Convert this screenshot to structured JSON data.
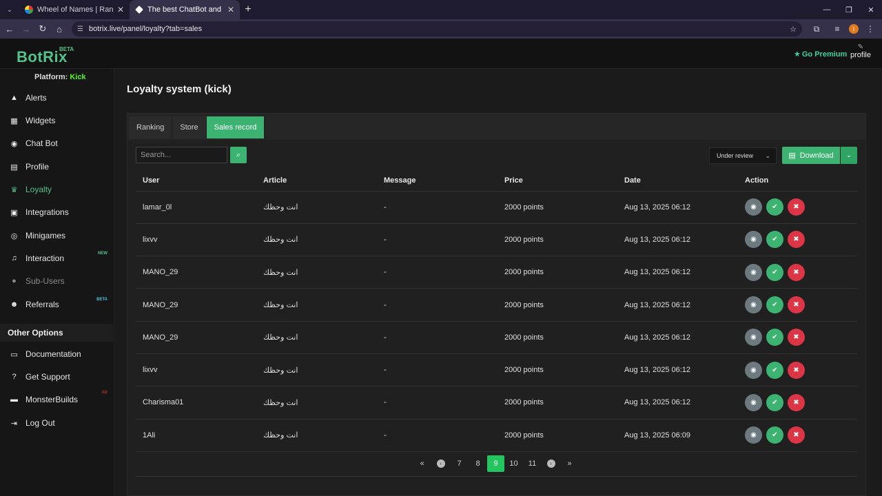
{
  "browser": {
    "tabs": [
      {
        "title": "Wheel of Names | Random nam",
        "active": false
      },
      {
        "title": "The best ChatBot and Widgets",
        "active": true
      }
    ],
    "url": "botrix.live/panel/loyalty?tab=sales",
    "profile_initial": "I"
  },
  "header": {
    "logo": "BotRix",
    "logo_badge": "BETA",
    "premium": "Go Premium",
    "profile": "profile"
  },
  "sidebar": {
    "platform_label": "Platform:",
    "platform_value": "Kick",
    "items": [
      {
        "label": "Alerts",
        "icon": "warning-icon"
      },
      {
        "label": "Widgets",
        "icon": "grid-icon"
      },
      {
        "label": "Chat Bot",
        "icon": "robot-icon"
      },
      {
        "label": "Profile",
        "icon": "id-card-icon"
      },
      {
        "label": "Loyalty",
        "icon": "trophy-icon"
      },
      {
        "label": "Integrations",
        "icon": "plug-icon"
      },
      {
        "label": "Minigames",
        "icon": "gamepad-icon"
      },
      {
        "label": "Interaction",
        "icon": "music-icon",
        "tag": "NEW"
      },
      {
        "label": "Sub-Users",
        "icon": "users-icon"
      },
      {
        "label": "Referrals",
        "icon": "people-icon",
        "tag": "BETA"
      }
    ],
    "other_options": "Other Options",
    "other_items": [
      {
        "label": "Documentation",
        "icon": "scroll-icon"
      },
      {
        "label": "Get Support",
        "icon": "question-icon"
      },
      {
        "label": "MonsterBuilds",
        "icon": "laptop-icon",
        "tag": "AD"
      },
      {
        "label": "Log Out",
        "icon": "logout-icon"
      }
    ]
  },
  "main": {
    "title": "Loyalty system (kick)",
    "tabs": [
      "Ranking",
      "Store",
      "Sales record"
    ],
    "search_placeholder": "Search...",
    "status_filter": "Under review",
    "download_label": "Download",
    "columns": [
      "User",
      "Article",
      "Message",
      "Price",
      "Date",
      "Action"
    ],
    "rows": [
      {
        "user": "lamar_0l",
        "article": "انت وحظك",
        "message": "-",
        "price": "2000 points",
        "date": "Aug 13, 2025 06:12"
      },
      {
        "user": "lixvv",
        "article": "انت وحظك",
        "message": "-",
        "price": "2000 points",
        "date": "Aug 13, 2025 06:12"
      },
      {
        "user": "MANO_29",
        "article": "انت وحظك",
        "message": "-",
        "price": "2000 points",
        "date": "Aug 13, 2025 06:12"
      },
      {
        "user": "MANO_29",
        "article": "انت وحظك",
        "message": "-",
        "price": "2000 points",
        "date": "Aug 13, 2025 06:12"
      },
      {
        "user": "MANO_29",
        "article": "انت وحظك",
        "message": "-",
        "price": "2000 points",
        "date": "Aug 13, 2025 06:12"
      },
      {
        "user": "lixvv",
        "article": "انت وحظك",
        "message": "-",
        "price": "2000 points",
        "date": "Aug 13, 2025 06:12"
      },
      {
        "user": "Charisma01",
        "article": "انت وحظك",
        "message": "-",
        "price": "2000 points",
        "date": "Aug 13, 2025 06:12"
      },
      {
        "user": "1Ali",
        "article": "انت وحظك",
        "message": "-",
        "price": "2000 points",
        "date": "Aug 13, 2025 06:09"
      }
    ],
    "pagination": {
      "first": "«",
      "prev": "‹",
      "pages": [
        "7",
        "8",
        "9",
        "10",
        "11"
      ],
      "current": "9",
      "next": "›",
      "last": "»"
    }
  },
  "colors": {
    "accent": "#3cb371",
    "danger": "#dc3545",
    "kick": "#53fc18"
  }
}
